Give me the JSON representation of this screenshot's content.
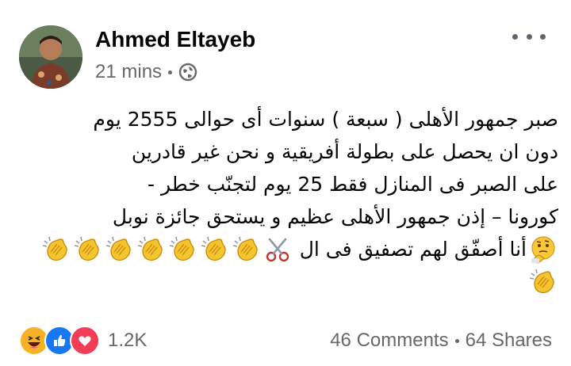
{
  "post": {
    "author": "Ahmed Eltayeb",
    "time": "21 mins",
    "privacy_icon": "globe-icon",
    "more_icon": "more-options-icon",
    "lines": [
      "صبر جمهور الأهلى ( سبعة ) سنوات   أى  حوالى 2555 يوم",
      "دون  ان يحصل على بطولة أفريقية  و نحن  غير قادرين",
      "على  الصبر فى المنازل   فقط 25 يوم  لتجنّب  خطر -",
      "كورونا – إذن جمهور الأهلى عظيم و يستحق جائزة  نوبل",
      "أنا أصفّق لهم  تصفيق فى ال"
    ],
    "emojis_line5": [
      "thinking-face-emoji",
      "scissors-emoji",
      "clapping-hands-emoji",
      "clapping-hands-emoji",
      "clapping-hands-emoji",
      "clapping-hands-emoji",
      "clapping-hands-emoji",
      "clapping-hands-emoji",
      "clapping-hands-emoji"
    ],
    "emojis_line6": [
      "clapping-hands-emoji"
    ]
  },
  "footer": {
    "reactions": [
      "haha-reaction-icon",
      "like-reaction-icon",
      "love-reaction-icon"
    ],
    "reaction_count": "1.2K",
    "comments": "46 Comments",
    "shares": "64 Shares"
  },
  "colors": {
    "author": "#050505",
    "meta": "#65676b",
    "like_blue": "#1877f2",
    "love_red": "#f33e58",
    "haha_yellow": "#f7b125"
  }
}
